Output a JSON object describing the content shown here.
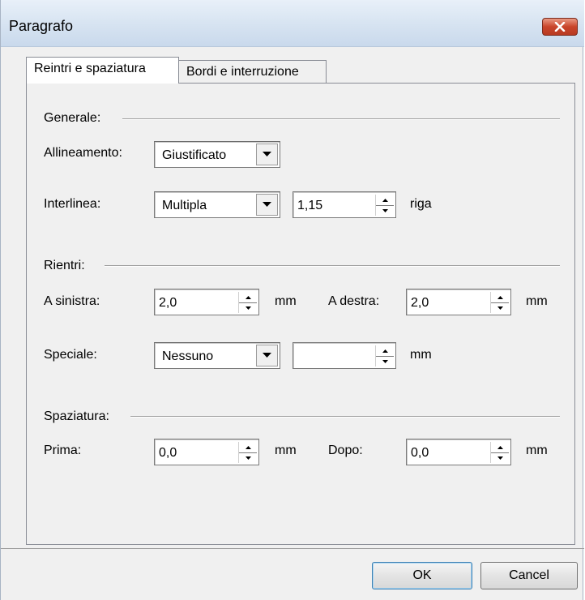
{
  "window": {
    "title": "Paragrafo"
  },
  "tabs": [
    {
      "label": "Reintri e spaziatura",
      "active": true
    },
    {
      "label": "Bordi e interruzione",
      "active": false
    }
  ],
  "general": {
    "heading": "Generale:",
    "alignment_label": "Allineamento:",
    "alignment_value": "Giustificato",
    "line_spacing_label": "Interlinea:",
    "line_spacing_value": "Multipla",
    "line_spacing_amount": "1,15",
    "line_spacing_unit": "riga"
  },
  "indents": {
    "heading": "Rientri:",
    "left_label": "A sinistra:",
    "left_value": "2,0",
    "left_unit": "mm",
    "right_label": "A destra:",
    "right_value": "2,0",
    "right_unit": "mm",
    "special_label": "Speciale:",
    "special_value": "Nessuno",
    "special_amount": "",
    "special_unit": "mm"
  },
  "spacing": {
    "heading": "Spaziatura:",
    "before_label": "Prima:",
    "before_value": "0,0",
    "before_unit": "mm",
    "after_label": "Dopo:",
    "after_value": "0,0",
    "after_unit": "mm"
  },
  "buttons": {
    "ok": "OK",
    "cancel": "Cancel"
  },
  "icons": {
    "close": "close-icon",
    "dropdown": "chevron-down-icon",
    "spin_up": "spin-up-icon",
    "spin_down": "spin-down-icon"
  }
}
